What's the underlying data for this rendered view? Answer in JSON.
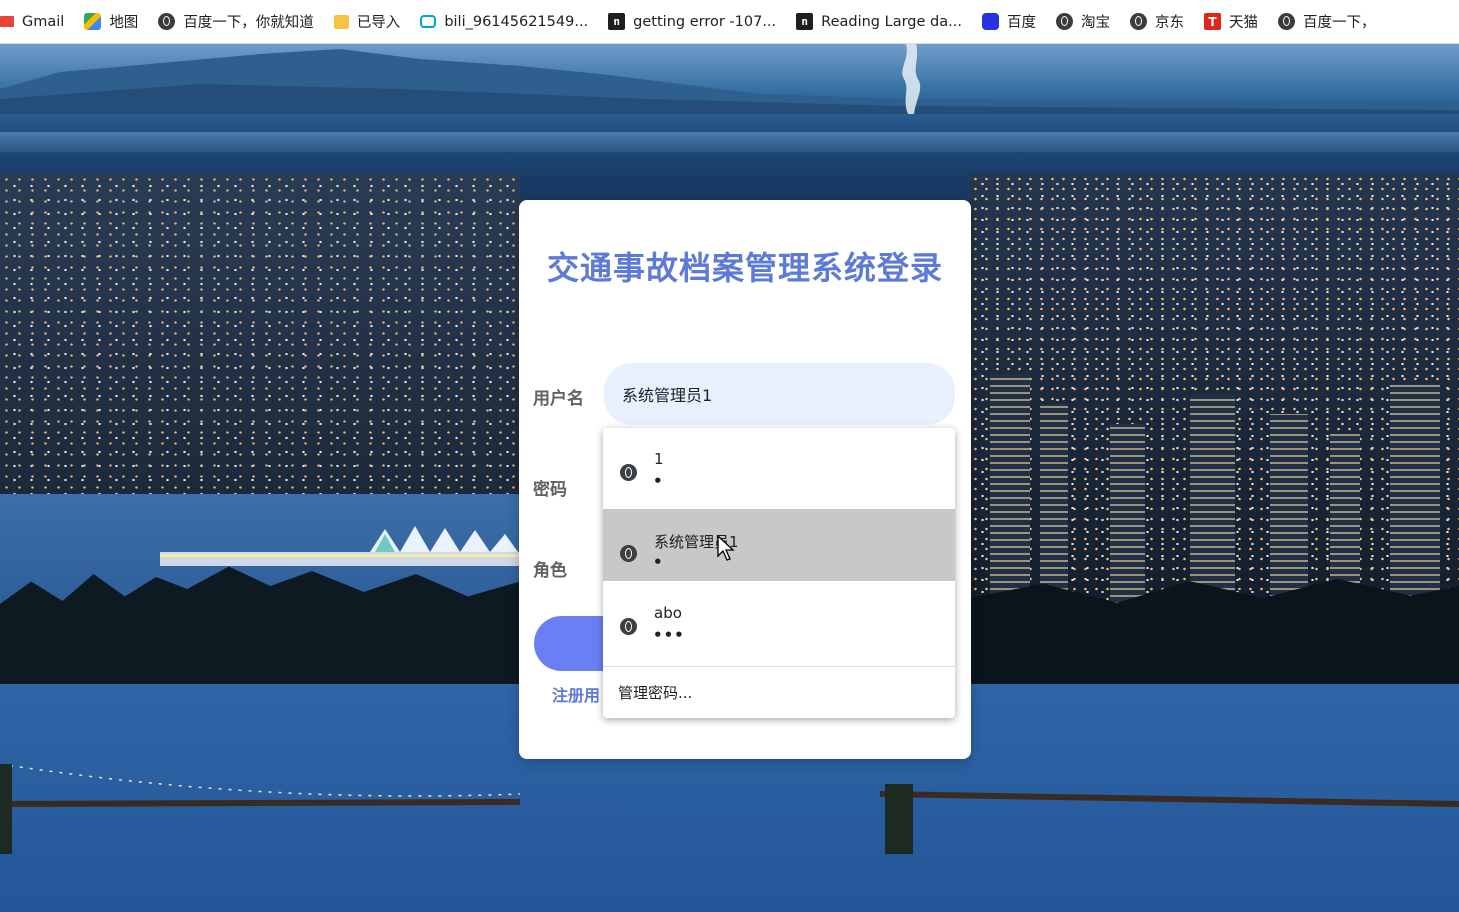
{
  "bookmarks": [
    {
      "label": "Gmail",
      "icon": "gmail-icon"
    },
    {
      "label": "地图",
      "icon": "maps-icon"
    },
    {
      "label": "百度一下，你就知道",
      "icon": "globe-icon"
    },
    {
      "label": "已导入",
      "icon": "folder-icon"
    },
    {
      "label": "bili_96145621549...",
      "icon": "bilibili-icon"
    },
    {
      "label": "getting error -107...",
      "icon": "n-logo-icon"
    },
    {
      "label": "Reading Large da...",
      "icon": "n-logo-icon"
    },
    {
      "label": "百度",
      "icon": "baidu-icon"
    },
    {
      "label": "淘宝",
      "icon": "globe-icon"
    },
    {
      "label": "京东",
      "icon": "globe-icon"
    },
    {
      "label": "天猫",
      "icon": "tmall-icon"
    },
    {
      "label": "百度一下，",
      "icon": "globe-icon"
    }
  ],
  "login": {
    "title": "交通事故档案管理系统登录",
    "username_label": "用户名",
    "username_value": "系统管理员1",
    "password_label": "密码",
    "role_label": "角色",
    "register_link": "注册用"
  },
  "autofill": {
    "items": [
      {
        "user": "1",
        "pass": "•"
      },
      {
        "user": "系统管理员1",
        "pass": "•"
      },
      {
        "user": "abo",
        "pass": "•••"
      }
    ],
    "manage_label": "管理密码..."
  },
  "colors": {
    "accent": "#5c7ad6",
    "button": "#6b7ff5",
    "autofill_bg": "#e8f0fe",
    "hover_row": "#c8c8c8"
  }
}
